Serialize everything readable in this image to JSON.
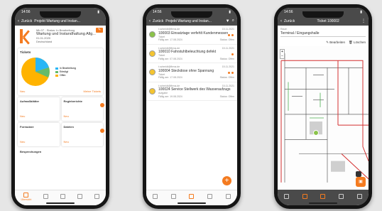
{
  "status_time": "14:56",
  "back_label": "Zurück",
  "phone1": {
    "appbar_title": "Projekt Wartung und Instan...",
    "project": {
      "line1": "Mb 07 - Status: In Bearbeitung",
      "name": "Wartung und Instandhaltung Allg...",
      "date": "01.01.2020",
      "location": "Deutschland"
    },
    "tickets_card": {
      "title": "Tickets",
      "legend": [
        "In Bearbeitung",
        "Erledigt",
        "Offen"
      ],
      "legend_colors": [
        "#29b6f6",
        "#66bb6a",
        "#ffb300"
      ],
      "new_link": "Neu",
      "more_link": "Meine Tickets"
    },
    "tiles": [
      {
        "title": "Aufmaßblätter",
        "new": "Neu"
      },
      {
        "title": "Regieberichte",
        "new": "Neu"
      },
      {
        "title": "Formulare",
        "new": "Neu"
      },
      {
        "title": "Dateien",
        "new": "Neu"
      }
    ],
    "partial_card": "Besprechungen",
    "nav": [
      "Übersicht",
      "",
      "",
      "",
      ""
    ]
  },
  "phone2": {
    "appbar_title": "Projekt Wartung und Instan...",
    "tickets": [
      {
        "email": "t.schmidt@firma.de",
        "date": "15.11.2021",
        "title": "100003 Einsatztage verfehlt Kundenmessen",
        "sub": "Ticket",
        "left": "Fällig am: 17.08.2024",
        "right": "Status: Offen",
        "color": "green"
      },
      {
        "email": "t.schmidt@firma.de",
        "date": "15.11.2021",
        "title": "100010 Fahrstuhlbeleuchtung defekt",
        "sub": "Ticket",
        "left": "Fällig am: 07.08.2024",
        "right": "Status: Offen",
        "color": "yellow"
      },
      {
        "email": "t.schmidt@firma.de",
        "date": "15.11.2021",
        "title": "100004 Steckdose ohne Spannung",
        "sub": "Ticket",
        "left": "Fällig am: 17.08.2024",
        "right": "Status: Offen",
        "color": "yellow"
      },
      {
        "email": "t.schmidt@firma.de",
        "date": "15.11.2021",
        "title": "100024 Service Stellwerk des Wasseraufzugs",
        "sub": "Aufgabe",
        "left": "Fällig am: 19.08.2024",
        "right": "Status: Offen",
        "color": "yellow"
      }
    ],
    "fab": "+"
  },
  "phone3": {
    "appbar_title": "Ticket 100002",
    "field_label": "Raum",
    "field_value": "Terminal / Eingangshalle",
    "edit_label": "Bearbeiten",
    "delete_label": "Löschen",
    "zoom_in": "+",
    "zoom_out": "−",
    "nav": [
      "",
      "",
      "",
      "",
      ""
    ]
  }
}
